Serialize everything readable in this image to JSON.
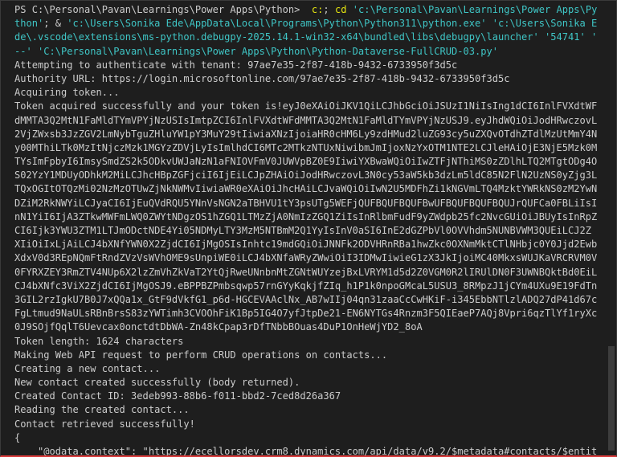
{
  "terminal": {
    "prompt": "PS C:\\Personal\\Pavan\\Learnings\\Power Apps\\Python>",
    "command_lines": [
      [
        {
          "t": "PS C:\\Personal\\Pavan\\Learnings\\Power Apps\\Python> ",
          "c": "w"
        },
        {
          "t": " c:",
          "c": "y"
        },
        {
          "t": "; ",
          "c": "w"
        },
        {
          "t": "cd ",
          "c": "y"
        },
        {
          "t": "'c:\\Personal\\Pavan\\Learnings\\Power Apps\\Py",
          "c": "c"
        }
      ],
      [
        {
          "t": "thon'",
          "c": "c"
        },
        {
          "t": "; & ",
          "c": "w"
        },
        {
          "t": "'c:\\Users\\Sonika Ede\\AppData\\Local\\Programs\\Python\\Python311\\python.exe' 'c:\\Users\\Sonika E",
          "c": "c"
        }
      ],
      [
        {
          "t": "de\\.vscode\\extensions\\ms-python.debugpy-2025.14.1-win32-x64\\bundled\\libs\\debugpy\\launcher' '54741' '",
          "c": "c"
        }
      ],
      [
        {
          "t": "--' 'C:\\Personal\\Pavan\\Learnings\\Power Apps\\Python\\Python-Dataverse-FullCRUD-03.py'",
          "c": "c"
        }
      ]
    ],
    "output_lines": [
      "Attempting to authenticate with tenant: 97ae7e35-2f87-418b-9432-6733950f3d5c",
      "Authority URL: https://login.microsoftonline.com/97ae7e35-2f87-418b-9432-6733950f3d5c",
      "Acquiring token...",
      "Token acquired successfully and your token is!eyJ0eXAiOiJKV1QiLCJhbGciOiJSUzI1NiIsIng1dCI6InlFVXdtWF",
      "dMMTA3Q2MtN1FaMldTYmVPYjNzUSIsImtpZCI6InlFVXdtWFdMMTA3Q2MtN1FaMldTYmVPYjNzUSJ9.eyJhdWQiOiJodHRwczovL",
      "2VjZWxsb3JzZGV2LmNybTguZHluYW1pY3MuY29tIiwiaXNzIjoiaHR0cHM6Ly9zdHMud2luZG93cy5uZXQvOTdhZTdlMzUtMmY4N",
      "y00MThiLTk0MzItNjczMzk1MGYzZDVjLyIsImlhdCI6MTc2MTkzNTUxNiwibmJmIjoxNzYxOTM1NTE2LCJleHAiOjE3NjE5Mzk0M",
      "TYsImFpbyI6ImsySmdZS2k5ODkvUWJaNzN1aFNIOVFmV0JUWVpBZ0E9IiwiYXBwaWQiOiIwZTFjNThiMS0zZDlhLTQ2MTgtODg4O",
      "S02YzY1MDUyODhkM2MiLCJhcHBpZGFjciI6IjEiLCJpZHAiOiJodHRwczovL3N0cy53aW5kb3dzLm5ldC85N2FlN2UzNS0yZjg3L",
      "TQxOGItOTQzMi02NzMzOTUwZjNkNWMvIiwiaWR0eXAiOiJhcHAiLCJvaWQiOiIwN2U5MDFhZi1kNGVmLTQ4MzktYWRkNS0zM2YwN",
      "DZiM2RkNWYiLCJyaCI6IjEuQVdRQU5YNnVsNGN2aTBHVU1tY3psUTg5WEFjQUFBQUFBQUFBwUFBQUFBQUFBQUJrQUFCa0FBLiIsI",
      "nN1YiI6IjA3ZTkwMWFmLWQ0ZWYtNDgzOS1hZGQ1LTMzZjA0NmIzZGQ1ZiIsInRlbmFudF9yZWdpb25fc2NvcGUiOiJBUyIsInRpZ",
      "CI6Ijk3YWU3ZTM1LTJmODctNDE4Yi05NDMyLTY3MzM5NTBmM2Q1YyIsInV0aSI6InE2dGZPbVl0OVVhdm5NUNBVWM3QUEiLCJ2Z",
      "XIiOiIxLjAiLCJ4bXNfYWN0X2ZjdCI6IjMgOSIsInhtc19mdGQiOiJNNFk2ODVHRnRBa1hwZkc0OXNmMktCTlNHbjc0Y0Jjd2Ewb",
      "XdxV0d3REpNQmFtRndZVzVsWVhOME9sUnpiWE0iLCJ4bXNfaWRyZWwiOiI3IDMwIiwieG1zX3JkIjoiMC40MkxsWUJKaVRCRVM0V",
      "0FYRXZEY3RmZTV4NUp6X2lzZmVhZkVaT2YtQjRweUNnbnMtZGNtWUYzejBxLVRYM1d5d2Z0VGM0R2lIRUlDN0F3UWNBQktBd0EiL",
      "CJ4bXNfc3ViX2ZjdCI6IjMgOSJ9.eBPPBZPmbsqwp57rnGYyKqkjfZIq_h1P1k0npoGMcaL5USU3_8RMpzJ1jCYm4UXu9E19FdTn",
      "3GIL2rzIgkU7B0J7xQQa1x_GtF9dVkfG1_p6d-HGCEVAAclNx_AB7wIIj04qn31zaaCcCwHKiF-i345EbbNTlzlADQ27dP41d67c",
      "FgLtmud9NaULsRBnBrsS83zYWTimh3CVOOhFiK1Bp5IG4O7yfJtpDe21-EN6NYTGs4Rnzm3F5QIEaeP7AQj8Vpri6qzTlYf1ryXc",
      "0J9SOjfQqlT6Uevcax0onctdtDbWA-Zn48kCpap3rDfTNbbBOuas4DuP1OnHeWjYD2_8oA",
      "Token length: 1624 characters",
      "Making Web API request to perform CRUD operations on contacts...",
      "Creating a new contact...",
      "New contact created successfully (body returned).",
      "Created Contact ID: 3edeb993-88b6-f011-bbd2-7ced8d26a367",
      "Reading the created contact...",
      "Contact retrieved successfully!",
      "{",
      "    \"@odata.context\": \"https://ecellorsdev.crm8.dynamics.com/api/data/v9.2/$metadata#contacts/$entit"
    ]
  },
  "colors": {
    "background": "#1e1e1e",
    "text": "#cccccc",
    "command": "#e5e510",
    "string": "#3fc6c6",
    "bottom_border": "#d93a3a"
  }
}
